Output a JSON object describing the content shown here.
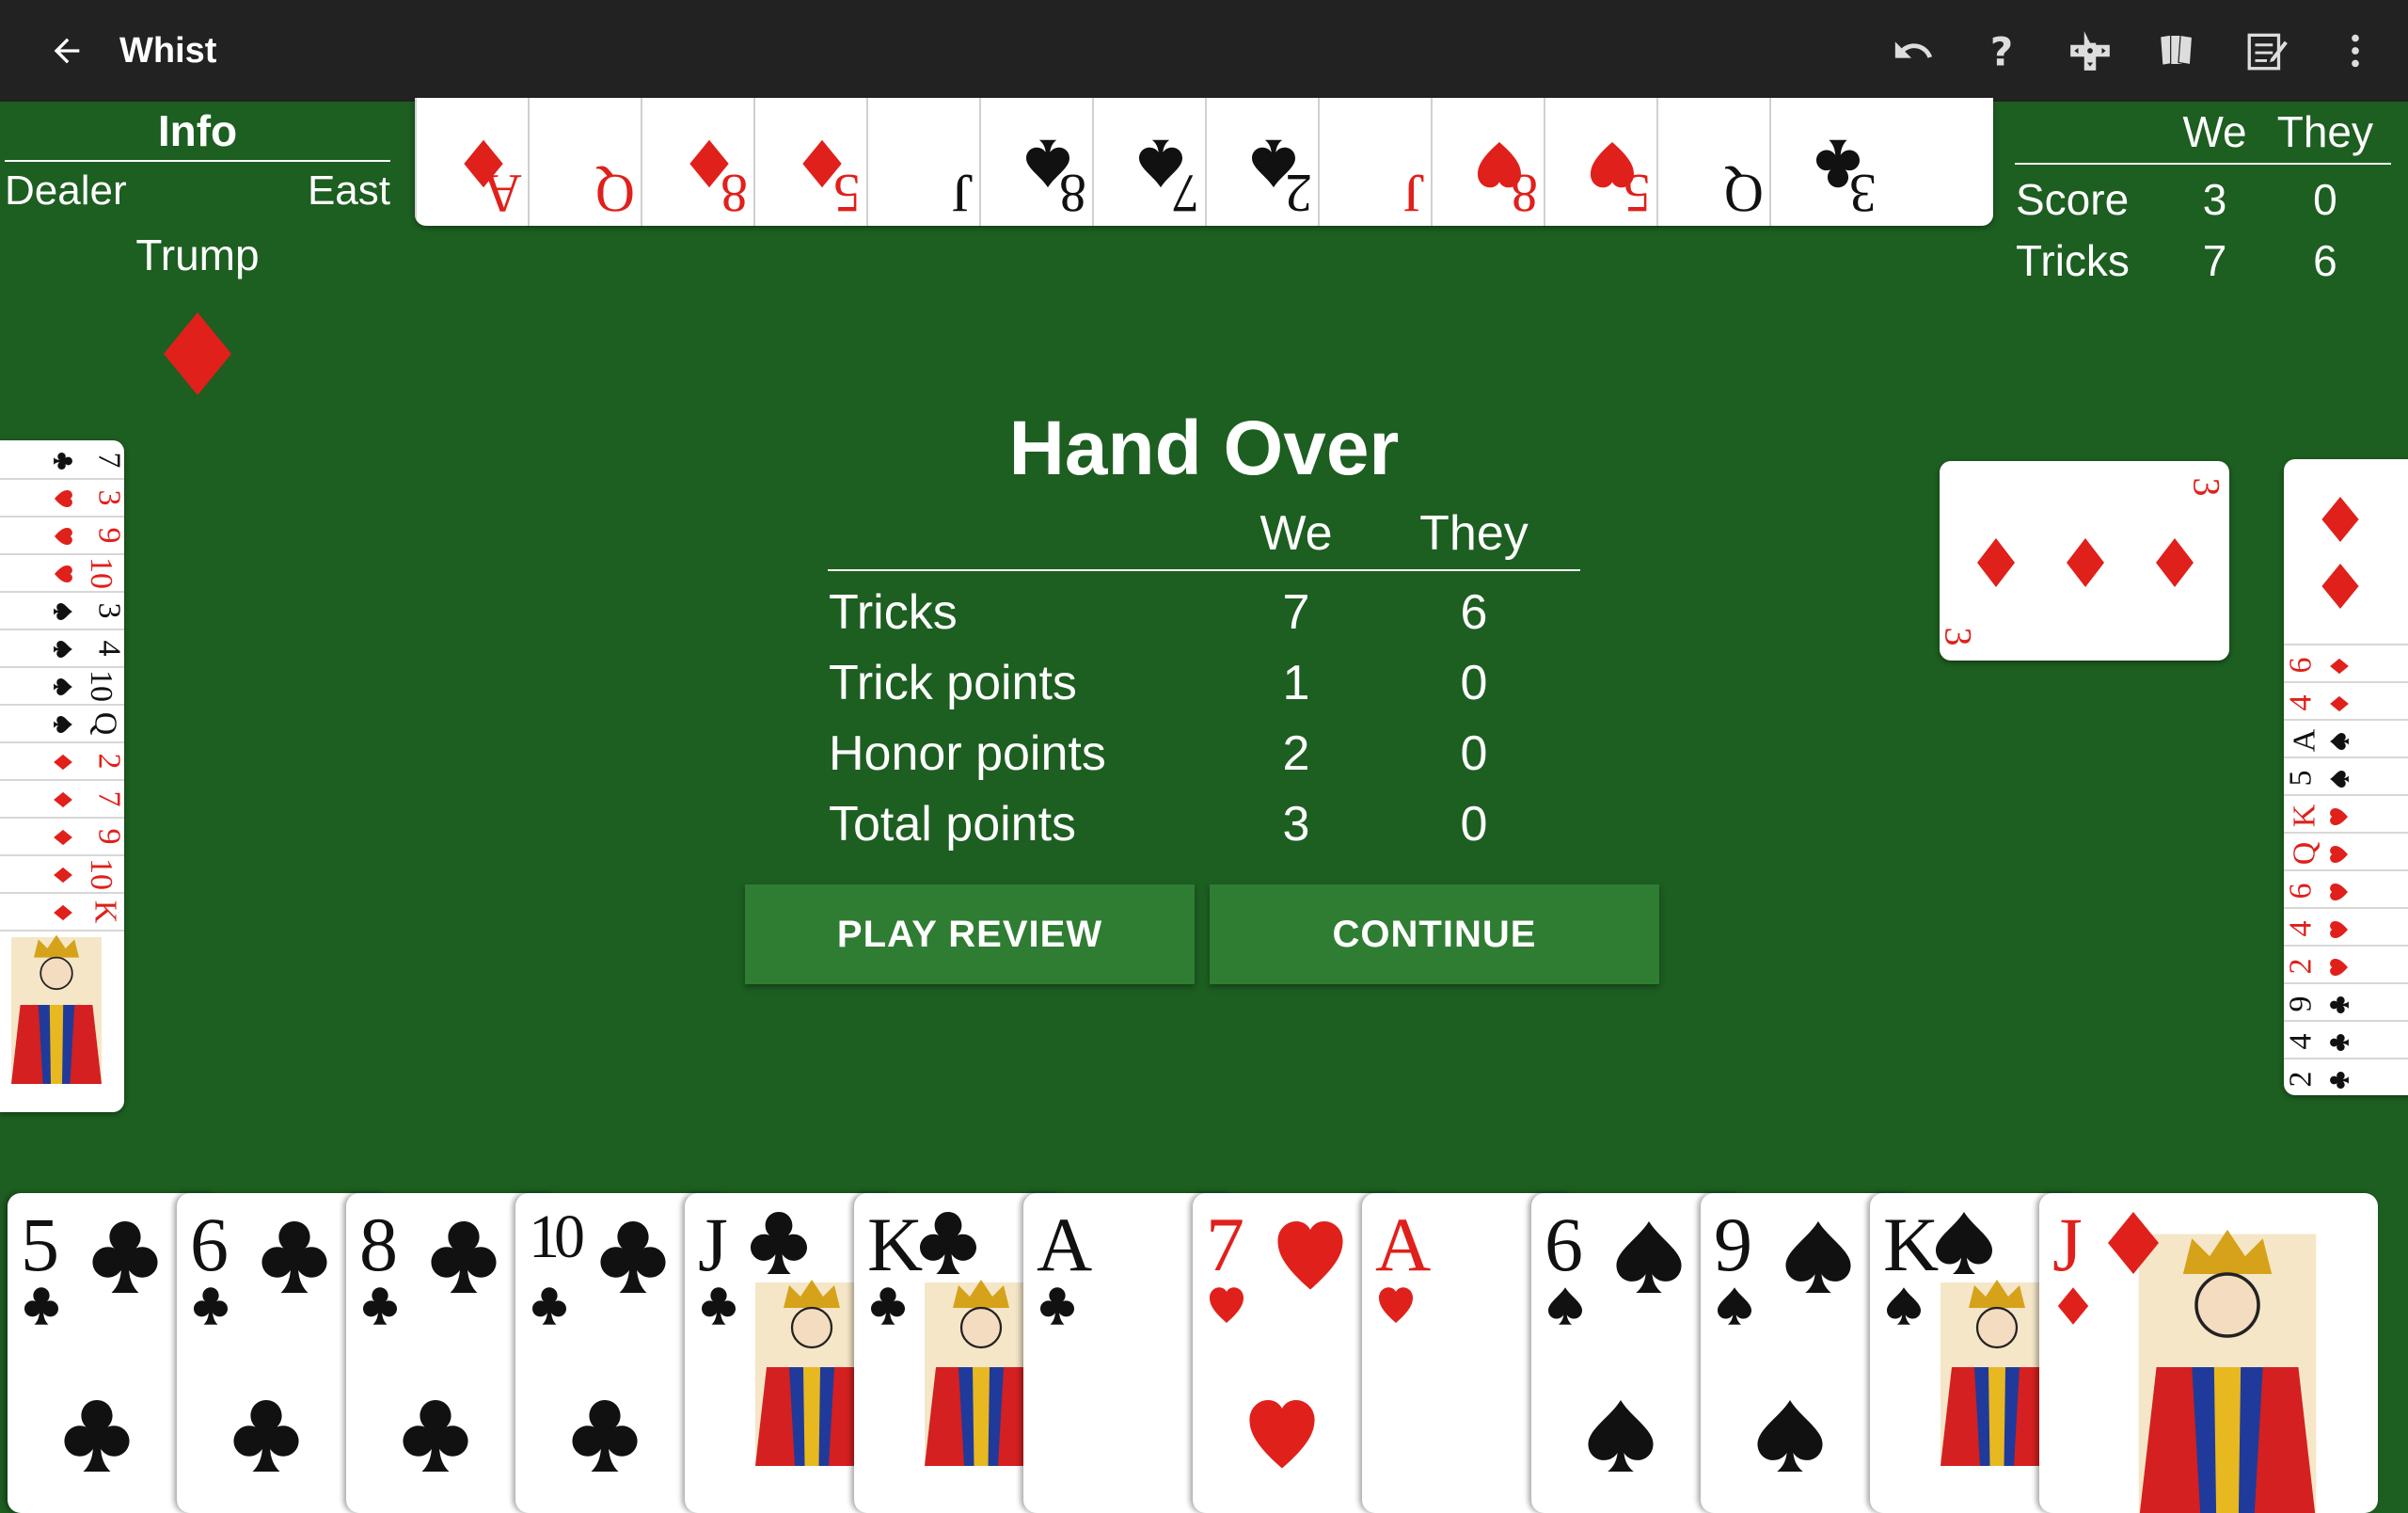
{
  "appbar": {
    "title": "Whist",
    "icons": [
      "arrow-back-icon",
      "undo-icon",
      "help-icon",
      "dpad-icon",
      "cards-icon",
      "notepad-icon",
      "more-vert-icon"
    ]
  },
  "info": {
    "heading": "Info",
    "dealer_label": "Dealer",
    "dealer_value": "East",
    "trump_label": "Trump",
    "trump_suit": "diamonds"
  },
  "scoreboard": {
    "col_we": "We",
    "col_they": "They",
    "rows": [
      {
        "label": "Score",
        "we": "3",
        "they": "0"
      },
      {
        "label": "Tricks",
        "we": "7",
        "they": "6"
      }
    ]
  },
  "dialog": {
    "title": "Hand Over",
    "col_we": "We",
    "col_they": "They",
    "rows": [
      {
        "label": "Tricks",
        "we": "7",
        "they": "6"
      },
      {
        "label": "Trick points",
        "we": "1",
        "they": "0"
      },
      {
        "label": "Honor points",
        "we": "2",
        "they": "0"
      },
      {
        "label": "Total points",
        "we": "3",
        "they": "0"
      }
    ],
    "play_review": "PLAY REVIEW",
    "continue": "CONTINUE"
  },
  "north_hand": [
    {
      "rank": "A",
      "suit": "diamonds"
    },
    {
      "rank": "Q",
      "suit": "diamonds"
    },
    {
      "rank": "8",
      "suit": "diamonds"
    },
    {
      "rank": "5",
      "suit": "diamonds"
    },
    {
      "rank": "J",
      "suit": "spades"
    },
    {
      "rank": "8",
      "suit": "spades"
    },
    {
      "rank": "7",
      "suit": "spades"
    },
    {
      "rank": "2",
      "suit": "spades"
    },
    {
      "rank": "J",
      "suit": "hearts"
    },
    {
      "rank": "8",
      "suit": "hearts"
    },
    {
      "rank": "5",
      "suit": "hearts"
    },
    {
      "rank": "Q",
      "suit": "clubs"
    },
    {
      "rank": "3",
      "suit": "clubs"
    }
  ],
  "west_hand": [
    {
      "rank": "7",
      "suit": "clubs"
    },
    {
      "rank": "3",
      "suit": "hearts"
    },
    {
      "rank": "9",
      "suit": "hearts"
    },
    {
      "rank": "10",
      "suit": "hearts"
    },
    {
      "rank": "3",
      "suit": "spades"
    },
    {
      "rank": "4",
      "suit": "spades"
    },
    {
      "rank": "10",
      "suit": "spades"
    },
    {
      "rank": "Q",
      "suit": "spades"
    },
    {
      "rank": "2",
      "suit": "diamonds"
    },
    {
      "rank": "7",
      "suit": "diamonds"
    },
    {
      "rank": "9",
      "suit": "diamonds"
    },
    {
      "rank": "10",
      "suit": "diamonds"
    },
    {
      "rank": "K",
      "suit": "diamonds"
    }
  ],
  "east_hand": [
    {
      "rank": "6",
      "suit": "diamonds"
    },
    {
      "rank": "4",
      "suit": "diamonds"
    },
    {
      "rank": "A",
      "suit": "spades"
    },
    {
      "rank": "5",
      "suit": "spades"
    },
    {
      "rank": "K",
      "suit": "hearts"
    },
    {
      "rank": "Q",
      "suit": "hearts"
    },
    {
      "rank": "6",
      "suit": "hearts"
    },
    {
      "rank": "4",
      "suit": "hearts"
    },
    {
      "rank": "2",
      "suit": "hearts"
    },
    {
      "rank": "9",
      "suit": "clubs"
    },
    {
      "rank": "4",
      "suit": "clubs"
    },
    {
      "rank": "2",
      "suit": "clubs"
    }
  ],
  "played_card": {
    "rank": "3",
    "suit": "diamonds"
  },
  "south_hand": [
    {
      "rank": "5",
      "suit": "clubs"
    },
    {
      "rank": "6",
      "suit": "clubs"
    },
    {
      "rank": "8",
      "suit": "clubs"
    },
    {
      "rank": "10",
      "suit": "clubs"
    },
    {
      "rank": "J",
      "suit": "clubs"
    },
    {
      "rank": "K",
      "suit": "clubs"
    },
    {
      "rank": "A",
      "suit": "clubs"
    },
    {
      "rank": "7",
      "suit": "hearts"
    },
    {
      "rank": "A",
      "suit": "hearts"
    },
    {
      "rank": "6",
      "suit": "spades"
    },
    {
      "rank": "9",
      "suit": "spades"
    },
    {
      "rank": "K",
      "suit": "spades"
    },
    {
      "rank": "J",
      "suit": "diamonds"
    }
  ],
  "colors": {
    "felt": "#1d5e21",
    "appbar": "#222222",
    "button": "#2f7d33",
    "red_suit": "#e0201b",
    "black_suit": "#111111"
  }
}
